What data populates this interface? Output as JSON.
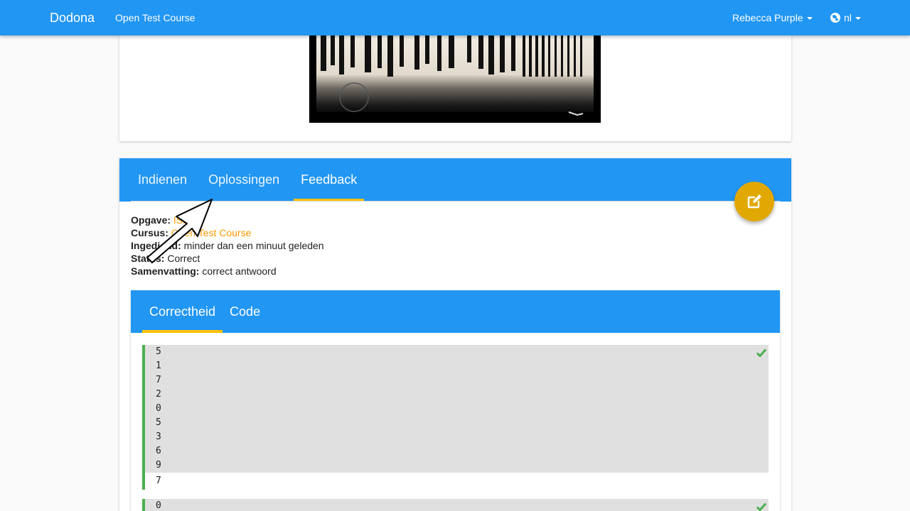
{
  "navbar": {
    "brand": "Dodona",
    "course": "Open Test Course",
    "user": "Rebecca Purple",
    "language": "nl"
  },
  "submission": {
    "tabs": [
      {
        "label": "Indienen",
        "active": false
      },
      {
        "label": "Oplossingen",
        "active": false
      },
      {
        "label": "Feedback",
        "active": true
      }
    ],
    "info": {
      "exercise_label": "Opgave:",
      "exercise_value": "ISBN",
      "course_label": "Cursus:",
      "course_value": "Open Test Course",
      "submitted_label": "Ingediend:",
      "submitted_value": "minder dan een minuut geleden",
      "status_label": "Status:",
      "status_value": "Correct",
      "summary_label": "Samenvatting:",
      "summary_value": "correct antwoord"
    }
  },
  "feedback": {
    "tabs": [
      {
        "label": "Correctheid",
        "active": true
      },
      {
        "label": "Code",
        "active": false
      }
    ],
    "tests": [
      {
        "input": [
          "5",
          "1",
          "7",
          "2",
          "0",
          "5",
          "3",
          "6",
          "9"
        ],
        "output": "7",
        "status": "correct"
      },
      {
        "input": [
          "0"
        ],
        "output": "",
        "status": "correct"
      }
    ]
  },
  "colors": {
    "primary": "#2196f3",
    "accent": "#ffc107",
    "fab": "#e0a800",
    "link": "#ff9800",
    "success": "#4caf50"
  },
  "icons": {
    "fab": "edit-icon",
    "language": "globe-icon",
    "test_status": "checkmark-icon"
  }
}
